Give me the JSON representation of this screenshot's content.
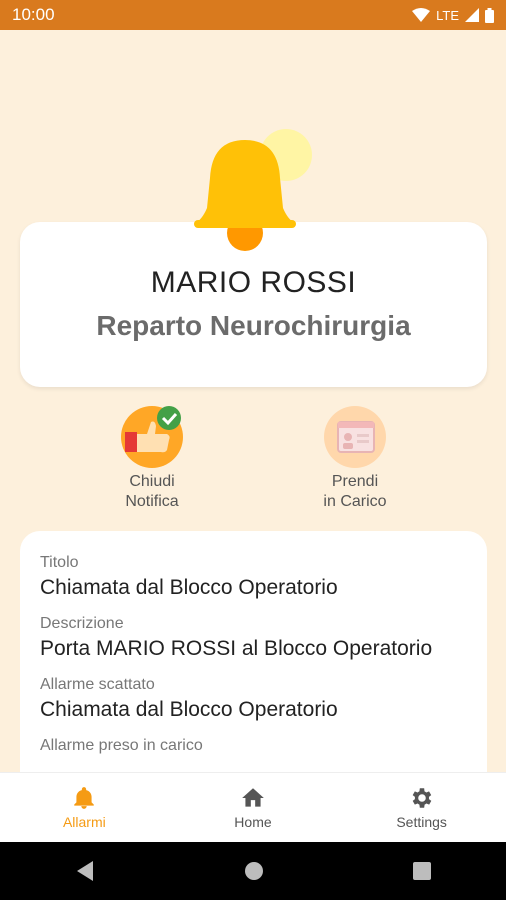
{
  "status_bar": {
    "time": "10:00",
    "network": "LTE"
  },
  "person_card": {
    "name": "MARIO ROSSI",
    "department": "Reparto Neurochirurgia"
  },
  "actions": [
    {
      "line1": "Chiudi",
      "line2": "Notifica",
      "icon": "thumbs-up-check-icon",
      "enabled": true
    },
    {
      "line1": "Prendi",
      "line2": "in Carico",
      "icon": "calendar-person-icon",
      "enabled": false
    }
  ],
  "details": [
    {
      "label": "Titolo",
      "value": "Chiamata dal Blocco Operatorio"
    },
    {
      "label": "Descrizione",
      "value": "Porta MARIO ROSSI al Blocco Operatorio"
    },
    {
      "label": "Allarme scattato",
      "value": "Chiamata dal Blocco Operatorio"
    },
    {
      "label": "Allarme preso in carico",
      "value": ""
    }
  ],
  "bottom_nav": [
    {
      "label": "Allarmi",
      "icon": "bell-icon",
      "active": true
    },
    {
      "label": "Home",
      "icon": "home-icon",
      "active": false
    },
    {
      "label": "Settings",
      "icon": "gear-icon",
      "active": false
    }
  ],
  "colors": {
    "status_bar": "#d97a1e",
    "background": "#fdf0dc",
    "accent": "#f59b14",
    "bell": "#ffc107"
  }
}
